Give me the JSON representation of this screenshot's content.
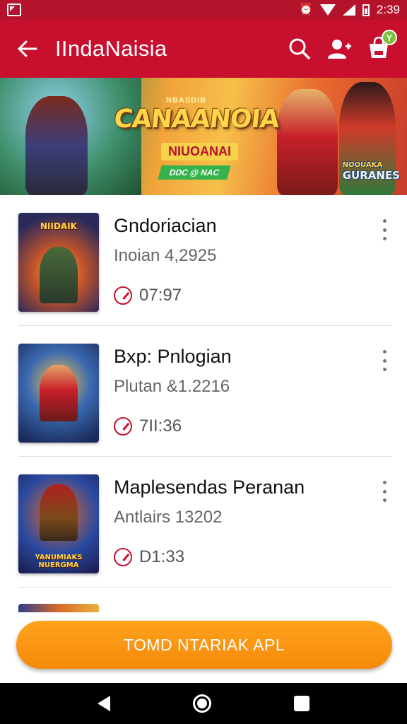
{
  "status_bar": {
    "time": "2:39",
    "icons": [
      "notification-icon",
      "alarm-icon",
      "wifi-icon",
      "signal-icon",
      "battery-icon"
    ]
  },
  "app_bar": {
    "title": "IIndaNaisia",
    "icons": [
      "back-arrow-icon",
      "search-icon",
      "account-icon",
      "cart-icon"
    ],
    "cart_badge": "Y"
  },
  "banner": {
    "top_text": "NBASDIB",
    "title": "CANAANOIA",
    "subtitle": "NIUOANAI",
    "badge": "DDC @ NAC",
    "corner_small": "NOOUAKA",
    "corner": "GURANES"
  },
  "items": [
    {
      "thumb_label": "NIIDAIK",
      "title": "Gndoriacian",
      "subtitle": "Inoian 4,2925",
      "time": "07:97"
    },
    {
      "thumb_label": "",
      "title": "Bxp: Pnlogian",
      "subtitle": "Plutan &1.2216",
      "time": "7II:36"
    },
    {
      "thumb_label": "YANUMIAKS NUERGMA",
      "title": "Maplesendas Peranan",
      "subtitle": "Antlairs 13202",
      "time": "D1:33"
    }
  ],
  "cta": {
    "label": "TOMD NTARIAK APL"
  },
  "colors": {
    "primary": "#c8102e",
    "status": "#b5122c",
    "cta": "#f58a0a",
    "badge": "#7cc142"
  }
}
